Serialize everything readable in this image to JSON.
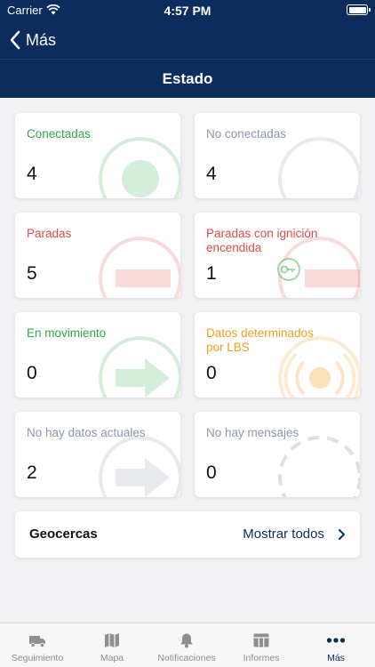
{
  "status_bar": {
    "carrier": "Carrier",
    "time": "4:57 PM"
  },
  "nav": {
    "back_label": "Más"
  },
  "page": {
    "title": "Estado"
  },
  "cards": [
    {
      "label": "Conectadas",
      "count": "4",
      "color": "#2ea84a"
    },
    {
      "label": "No conectadas",
      "count": "4",
      "color": "#8d98a6"
    },
    {
      "label": "Paradas",
      "count": "5",
      "color": "#e24a4a"
    },
    {
      "label": "Paradas con ignición encendida",
      "count": "1",
      "color": "#e24a4a"
    },
    {
      "label": "En movimiento",
      "count": "0",
      "color": "#2ea84a"
    },
    {
      "label": "Datos determinados por LBS",
      "count": "0",
      "color": "#f0a020"
    },
    {
      "label": "No hay datos actuales",
      "count": "2",
      "color": "#8d98a6"
    },
    {
      "label": "No hay mensajes",
      "count": "0",
      "color": "#8d98a6"
    }
  ],
  "geofences": {
    "title": "Geocercas",
    "link": "Mostrar todos"
  },
  "tabs": [
    {
      "label": "Seguimiento",
      "icon": "truck-icon"
    },
    {
      "label": "Mapa",
      "icon": "map-icon"
    },
    {
      "label": "Notificaciones",
      "icon": "bell-icon"
    },
    {
      "label": "Informes",
      "icon": "table-icon"
    },
    {
      "label": "Más",
      "icon": "more-icon",
      "active": true
    }
  ],
  "colors": {
    "brand": "#0c2c5e",
    "connected": "#2ea84a",
    "stopped": "#e24a4a",
    "lbs": "#f0a020",
    "neutral": "#8d98a6"
  }
}
